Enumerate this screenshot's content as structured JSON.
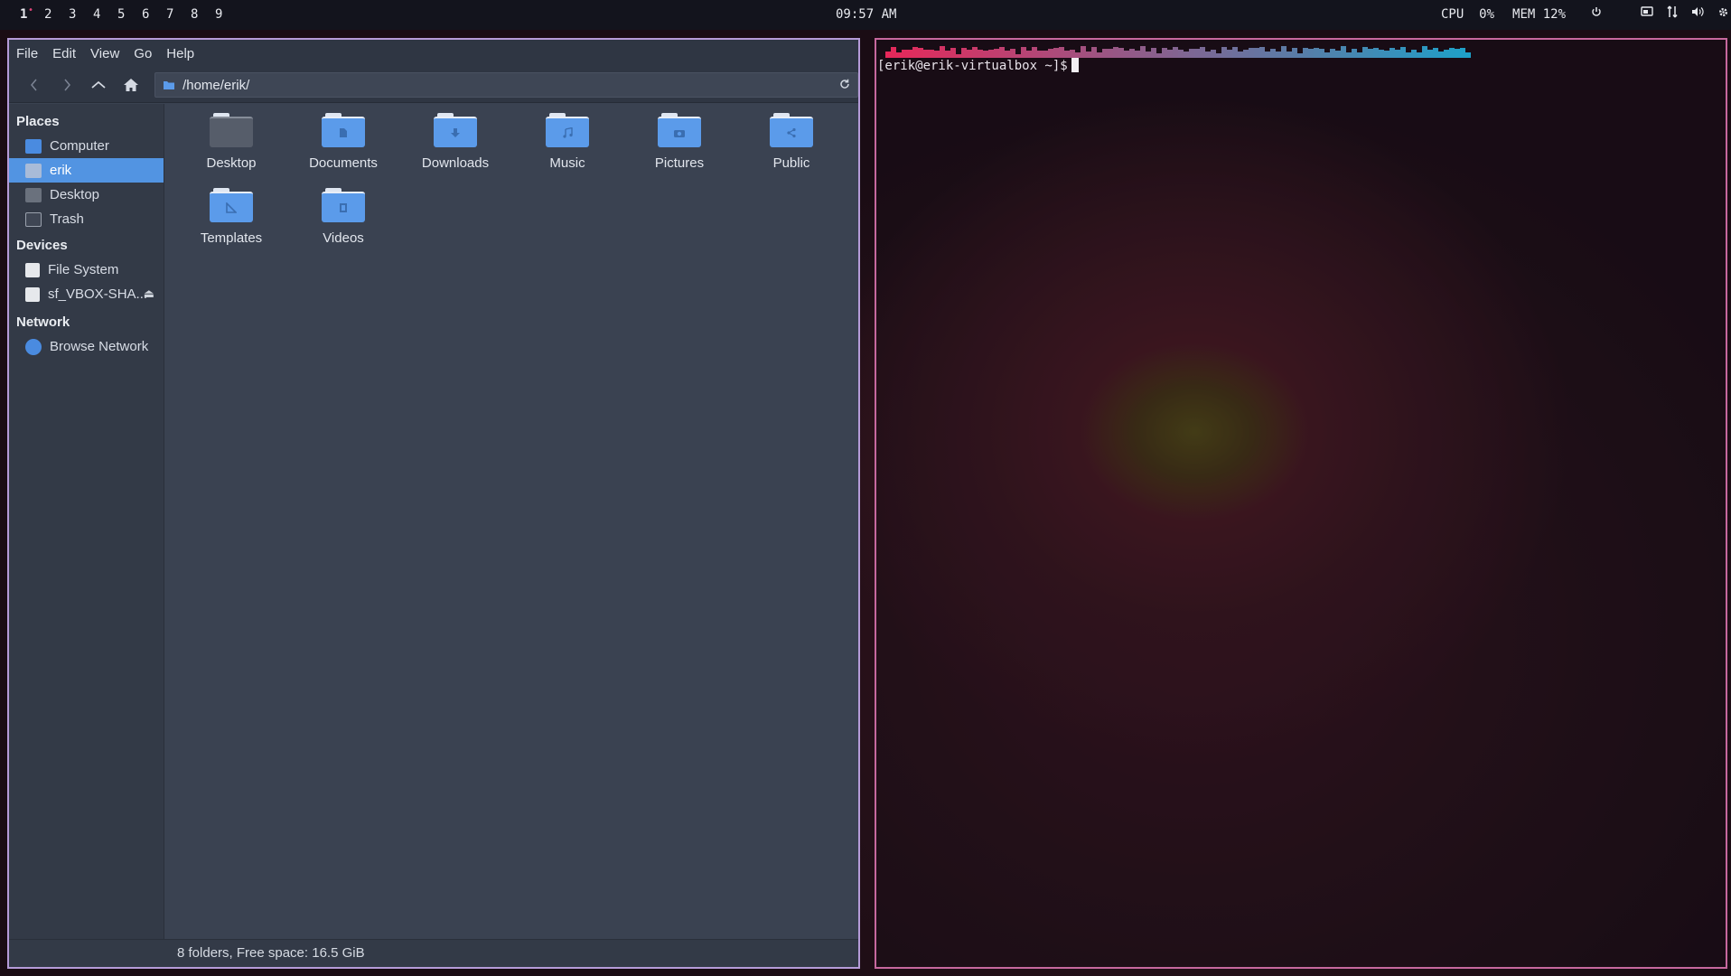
{
  "topbar": {
    "workspaces": [
      "1",
      "2",
      "3",
      "4",
      "5",
      "6",
      "7",
      "8",
      "9"
    ],
    "active_marker": "•",
    "clock": "09:57 AM",
    "cpu_label": "CPU",
    "cpu_value": "0%",
    "mem_label": "MEM",
    "mem_value": "12%",
    "tray_icons": [
      "power-icon",
      "display-icon",
      "network-icon",
      "volume-icon",
      "settings-icon"
    ]
  },
  "file_manager": {
    "menu": [
      "File",
      "Edit",
      "View",
      "Go",
      "Help"
    ],
    "path": "/home/erik/",
    "sidebar": {
      "places_title": "Places",
      "places": [
        "Computer",
        "erik",
        "Desktop",
        "Trash"
      ],
      "devices_title": "Devices",
      "devices": [
        "File System",
        "sf_VBOX-SHA..."
      ],
      "network_title": "Network",
      "network": [
        "Browse Network"
      ],
      "selected": "erik"
    },
    "folders": [
      {
        "name": "Desktop",
        "icon": "desktop-folder-icon"
      },
      {
        "name": "Documents",
        "icon": "documents-folder-icon"
      },
      {
        "name": "Downloads",
        "icon": "downloads-folder-icon"
      },
      {
        "name": "Music",
        "icon": "music-folder-icon"
      },
      {
        "name": "Pictures",
        "icon": "pictures-folder-icon"
      },
      {
        "name": "Public",
        "icon": "public-folder-icon"
      },
      {
        "name": "Templates",
        "icon": "templates-folder-icon"
      },
      {
        "name": "Videos",
        "icon": "videos-folder-icon"
      }
    ],
    "status": "8 folders, Free space: 16.5 GiB"
  },
  "terminal": {
    "prompt": "[erik@erik-virtualbox ~]$"
  },
  "colors": {
    "accent": "#5294e2",
    "fm_border": "#b59bd8",
    "term_border": "#c6689e"
  }
}
